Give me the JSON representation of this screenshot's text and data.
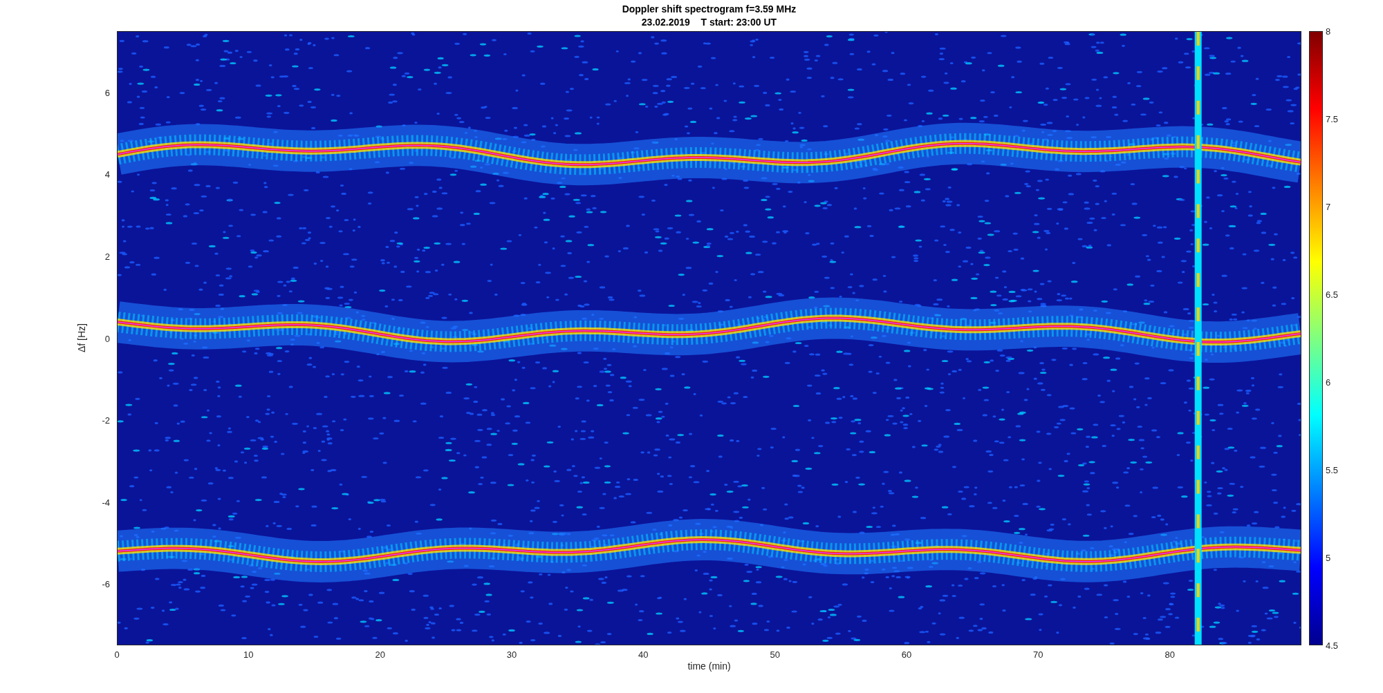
{
  "figure": {
    "title_lines": [
      "Doppler shift spectrogram f=3.59 MHz",
      "23.02.2019    T start: 23:00 UT"
    ],
    "ylabel": "Δf [Hz]",
    "xlabel": "time (min)",
    "yticks": [
      "6",
      "4",
      "2",
      "0",
      "-2",
      "-4",
      "-6"
    ],
    "xticks": [
      "0",
      "10",
      "20",
      "30",
      "40",
      "50",
      "60",
      "70",
      "80"
    ],
    "colorbar_ticks": [
      "8",
      "7.5",
      "7",
      "6.5",
      "6",
      "5.5",
      "5",
      "4.5"
    ]
  }
}
